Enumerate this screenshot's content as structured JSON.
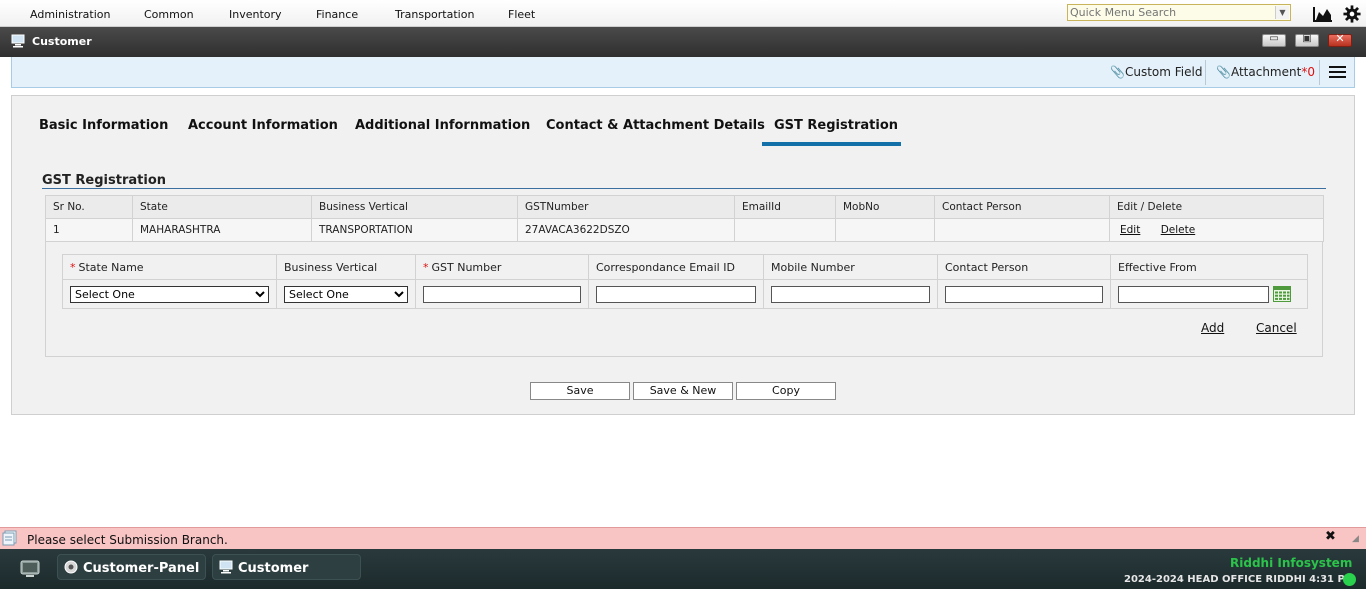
{
  "top_menu": {
    "items": [
      "Administration",
      "Common",
      "Inventory",
      "Finance",
      "Transportation",
      "Fleet"
    ],
    "quick_search_placeholder": "Quick Menu Search"
  },
  "window": {
    "title": "Customer"
  },
  "toolbar": {
    "custom_field": "Custom Field",
    "attachment_label": "Attachment",
    "attachment_count": "*0"
  },
  "tabs": [
    "Basic Information",
    "Account Information",
    "Additional Infornmation",
    "Contact & Attachment Details",
    "GST Registration"
  ],
  "active_tab": "GST Registration",
  "section": {
    "title": "GST Registration"
  },
  "gst_table": {
    "headers": [
      "Sr No.",
      "State",
      "Business Vertical",
      "GSTNumber",
      "EmailId",
      "MobNo",
      "Contact Person",
      "Edit / Delete"
    ],
    "rows": [
      {
        "sr_no": "1",
        "state": "MAHARASHTRA",
        "business_vertical": "TRANSPORTATION",
        "gst_number": "27AVACA3622DSZO",
        "email": "",
        "mobile": "",
        "contact_person": "",
        "edit": "Edit",
        "delete": "Delete"
      }
    ]
  },
  "form": {
    "required_mark": "*",
    "headers": {
      "state_name": "State Name",
      "business_vertical": "Business Vertical",
      "gst_number": "GST Number",
      "email": "Correspondance Email ID",
      "mobile": "Mobile Number",
      "contact_person": "Contact Person",
      "effective_from": "Effective From"
    },
    "state_select": "Select One",
    "business_vertical_select": "Select One",
    "values": {
      "gst_number": "",
      "email": "",
      "mobile": "",
      "contact_person": "",
      "effective_from": ""
    },
    "add_label": "Add",
    "cancel_label": "Cancel"
  },
  "buttons": {
    "save": "Save",
    "save_new": "Save & New",
    "copy": "Copy"
  },
  "status": {
    "message": "Please select Submission Branch.",
    "close": "✖"
  },
  "taskbar": {
    "tasks": [
      "Customer-Panel",
      "Customer"
    ],
    "brand": "Riddhi Infosystem",
    "info": "2024-2024 HEAD OFFICE RIDDHI 4:31 PM"
  }
}
